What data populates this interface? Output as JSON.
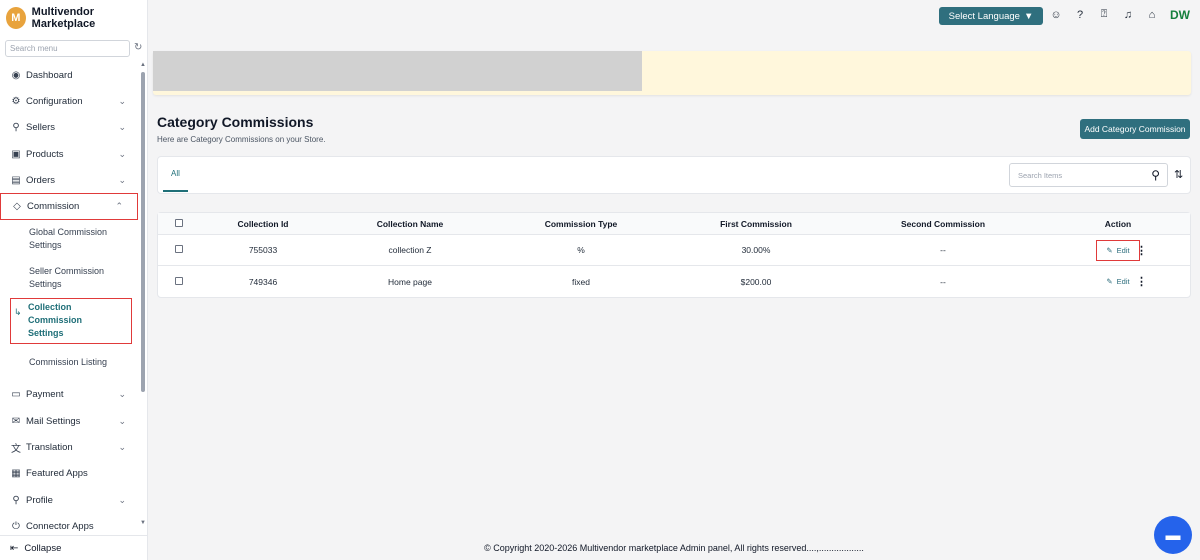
{
  "brand": {
    "initial": "M",
    "name": "Multivendor Marketplace"
  },
  "sidebar": {
    "search_placeholder": "Search menu",
    "items": [
      {
        "label": "Dashboard",
        "icon": "dashboard-icon",
        "glyph": "◉"
      },
      {
        "label": "Configuration",
        "icon": "settings-icon",
        "glyph": "⚙"
      },
      {
        "label": "Sellers",
        "icon": "user-icon",
        "glyph": "👤"
      },
      {
        "label": "Products",
        "icon": "box-icon",
        "glyph": "▣"
      },
      {
        "label": "Orders",
        "icon": "order-icon",
        "glyph": "▤"
      },
      {
        "label": "Commission",
        "icon": "diamond-icon",
        "glyph": "◇"
      }
    ],
    "commission_sub": [
      "Global Commission Settings",
      "Seller Commission Settings",
      "Collection Commission Settings",
      "Commission Listing"
    ],
    "items_after": [
      {
        "label": "Payment",
        "icon": "card-icon",
        "glyph": "▭"
      },
      {
        "label": "Mail Settings",
        "icon": "mail-icon",
        "glyph": "✉"
      },
      {
        "label": "Translation",
        "icon": "translate-icon",
        "glyph": "文"
      },
      {
        "label": "Featured Apps",
        "icon": "apps-icon",
        "glyph": "▦"
      },
      {
        "label": "Profile",
        "icon": "profile-icon",
        "glyph": "👤"
      },
      {
        "label": "Connector Apps",
        "icon": "plug-icon",
        "glyph": "⏻"
      }
    ],
    "collapse": "Collapse"
  },
  "topbar": {
    "language": "Select Language",
    "user_initials": "DW"
  },
  "page": {
    "title": "Category Commissions",
    "subtitle": "Here are Category Commissions on your Store.",
    "add_button": "Add Category Commission",
    "tab_all": "All",
    "search_placeholder": "Search Items"
  },
  "table": {
    "headers": [
      "Collection Id",
      "Collection Name",
      "Commission Type",
      "First Commission",
      "Second Commission",
      "Action"
    ],
    "edit_label": "Edit",
    "rows": [
      {
        "id": "755033",
        "name": "collection Z",
        "type": "%",
        "first": "30.00%",
        "second": "--"
      },
      {
        "id": "749346",
        "name": "Home page",
        "type": "fixed",
        "first": "$200.00",
        "second": "--"
      }
    ]
  },
  "footer": "© Copyright 2020-2026 Multivendor marketplace Admin panel, All rights reserved....,..................",
  "colors": {
    "accent": "#2f6f7e",
    "highlight": "#e03a3a",
    "brand": "#e8a33d",
    "chat": "#2563eb"
  }
}
